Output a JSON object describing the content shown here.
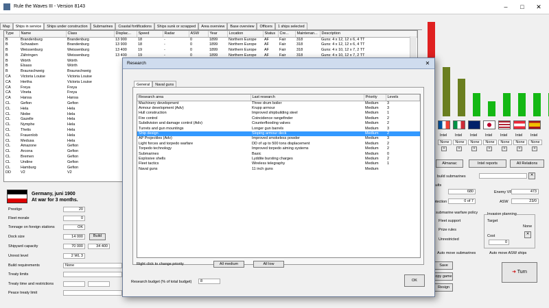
{
  "window": {
    "title": "Rule the Waves III - Version 8143"
  },
  "tabs": [
    "Map",
    "Ships in service",
    "Ships under construction",
    "Submarines",
    "Coastal fortifications",
    "Ships sunk or scrapped",
    "Area overview",
    "Base overview",
    "Officers",
    "1 ships selected"
  ],
  "ship_table": {
    "columns": [
      "Type",
      "Name",
      "Class",
      "Displac...",
      "Speed",
      "Radar",
      "ASW",
      "Year",
      "Location",
      "Status",
      "Cre...",
      "Maintenan...",
      "Description"
    ],
    "rows": [
      [
        "B",
        "Brandenburg",
        "Brandenburg",
        "13 900",
        "18",
        "-",
        "0",
        "1899",
        "Northern Europe",
        "AF",
        "Fair",
        "318",
        "Guns: 4 x 12, 12 x 6, 4 TT"
      ],
      [
        "B",
        "Schwaben",
        "Brandenburg",
        "13 900",
        "18",
        "-",
        "0",
        "1899",
        "Northern Europe",
        "AF",
        "Fair",
        "318",
        "Guns: 4 x 12, 12 x 6, 4 TT"
      ],
      [
        "B",
        "Weissenburg",
        "Weissenburg",
        "13 400",
        "19",
        "-",
        "0",
        "1899",
        "Northern Europe",
        "AF",
        "Fair",
        "318",
        "Guns: 4 x 10, 12 x 7, 2 TT"
      ],
      [
        "B",
        "Zähringen",
        "Weissenburg",
        "13 400",
        "19",
        "-",
        "0",
        "1899",
        "Northern Europe",
        "AF",
        "Fair",
        "318",
        "Guns: 4 x 10, 12 x 7, 2 TT"
      ],
      [
        "B",
        "Wörth",
        "Wörth",
        "",
        "",
        "",
        "",
        "",
        "",
        "",
        "",
        "",
        ""
      ],
      [
        "B",
        "Elsass",
        "Wörth",
        "",
        "",
        "",
        "",
        "",
        "",
        "",
        "",
        "",
        ""
      ],
      [
        "B",
        "Braunschweig",
        "Braunschweig",
        "",
        "",
        "",
        "",
        "",
        "",
        "",
        "",
        "",
        ""
      ],
      [
        "CA",
        "Victoria Louise",
        "Victoria Louise",
        "",
        "",
        "",
        "",
        "",
        "",
        "",
        "",
        "",
        ""
      ],
      [
        "CA",
        "Hertha",
        "Victoria Louise",
        "",
        "",
        "",
        "",
        "",
        "",
        "",
        "",
        "",
        ""
      ],
      [
        "CA",
        "Freya",
        "Freya",
        "",
        "",
        "",
        "",
        "",
        "",
        "",
        "",
        "",
        ""
      ],
      [
        "CA",
        "Vineta",
        "Freya",
        "",
        "",
        "",
        "",
        "",
        "",
        "",
        "",
        "",
        ""
      ],
      [
        "CA",
        "Hansa",
        "Hansa",
        "",
        "",
        "",
        "",
        "",
        "",
        "",
        "",
        "",
        ""
      ],
      [
        "CL",
        "Gefion",
        "Gefion",
        "",
        "",
        "",
        "",
        "",
        "",
        "",
        "",
        "",
        ""
      ],
      [
        "CL",
        "Hela",
        "Hela",
        "",
        "",
        "",
        "",
        "",
        "",
        "",
        "",
        "",
        ""
      ],
      [
        "CL",
        "Niobe",
        "Hela",
        "",
        "",
        "",
        "",
        "",
        "",
        "",
        "",
        "",
        ""
      ],
      [
        "CL",
        "Gazelle",
        "Hela",
        "",
        "",
        "",
        "",
        "",
        "",
        "",
        "",
        "",
        ""
      ],
      [
        "CL",
        "Nymphe",
        "Hela",
        "",
        "",
        "",
        "",
        "",
        "",
        "",
        "",
        "",
        ""
      ],
      [
        "CL",
        "Thetis",
        "Hela",
        "",
        "",
        "",
        "",
        "",
        "",
        "",
        "",
        "",
        ""
      ],
      [
        "CL",
        "Frauenlob",
        "Hela",
        "",
        "",
        "",
        "",
        "",
        "",
        "",
        "",
        "",
        ""
      ],
      [
        "CL",
        "Medusa",
        "Hela",
        "",
        "",
        "",
        "",
        "",
        "",
        "",
        "",
        "",
        ""
      ],
      [
        "CL",
        "Amazone",
        "Gefion",
        "",
        "",
        "",
        "",
        "",
        "",
        "",
        "",
        "",
        ""
      ],
      [
        "CL",
        "Arcona",
        "Gefion",
        "",
        "",
        "",
        "",
        "",
        "",
        "",
        "",
        "",
        ""
      ],
      [
        "CL",
        "Bremen",
        "Gefion",
        "",
        "",
        "",
        "",
        "",
        "",
        "",
        "",
        "",
        ""
      ],
      [
        "CL",
        "Undine",
        "Gefion",
        "",
        "",
        "",
        "",
        "",
        "",
        "",
        "",
        "",
        ""
      ],
      [
        "CL",
        "Hamburg",
        "Gefion",
        "",
        "",
        "",
        "",
        "",
        "",
        "",
        "",
        "",
        ""
      ],
      [
        "DD",
        "V2",
        "V2",
        "",
        "",
        "",
        "",
        "",
        "",
        "",
        "",
        "",
        ""
      ]
    ]
  },
  "status": {
    "country_line1": "Germany, juni 1900",
    "country_line2": "At war for 3 months.",
    "prestige_label": "Prestige",
    "prestige": "20",
    "morale_label": "Fleet morale",
    "morale": "0",
    "tonnage_label": "Tonnage on foreign stations",
    "tonnage": "OK",
    "dock_label": "Dock size",
    "dock": "14 000",
    "build_btn": "Build",
    "shipyard_label": "Shipyard capacity",
    "shipyard1": "70 000",
    "shipyard2": "34 400",
    "unrest_label": "Unrest level",
    "unrest": "2 WL 3",
    "build_req_label": "Build requirements",
    "build_req": "None",
    "treaty_limits": "Treaty limits",
    "treaty_time": "Treaty time and restrictions",
    "peace_treaty": "Peace treaty limit"
  },
  "dialog": {
    "title": "Research",
    "tabs": [
      "General",
      "Naval guns"
    ],
    "columns": [
      "Research area",
      "Last research",
      "Priority",
      "Levels"
    ],
    "rows": [
      [
        "Machinery development",
        "Three drum boiler",
        "Medium",
        "3"
      ],
      [
        "Armour development (Adv)",
        "Krupp armour",
        "Medium",
        "3"
      ],
      [
        "Hull construction",
        "Improved shipbuilding steel",
        "Medium",
        "1"
      ],
      [
        "Fire control",
        "Coincidence rangefinder",
        "Medium",
        "2"
      ],
      [
        "Subdivision and damage control (Adv)",
        "Counterflooding valves",
        "Medium",
        "2"
      ],
      [
        "Turrets and gun mountings",
        "Longer gun barrels",
        "Medium",
        "3"
      ],
      [
        "Ship design",
        "Sloping armour deck",
        "Medium",
        "2"
      ],
      [
        "AP Projectiles (Adv)",
        "Improved smokeless powder",
        "Medium",
        "3"
      ],
      [
        "Light forces and torpedo warfare",
        "DD of up to 500 tons displacement",
        "Medium",
        "2"
      ],
      [
        "Torpedo technology",
        "Improved torpedo aiming systems",
        "Medium",
        "2"
      ],
      [
        "Submarines",
        "Basic",
        "Medium",
        "0"
      ],
      [
        "Explosive shells",
        "Lyddite bursting charges",
        "Medium",
        "2"
      ],
      [
        "Fleet tactics",
        "Wireless telegraphy",
        "Medium",
        "1"
      ],
      [
        "Naval guns",
        "11 inch guns",
        "Medium",
        ""
      ]
    ],
    "selected_row": 6,
    "hint": "Right click to change priority",
    "all_medium": "All medium",
    "all_low": "All low",
    "budget_label": "Research budget (% of total budget)",
    "budget": "8",
    "ok": "OK"
  },
  "right_panel": {
    "bar_values": [
      1.0,
      0.52,
      0.4,
      0.25,
      0.16,
      0.25,
      0.25,
      0.25,
      0.25
    ],
    "bar_colors": [
      "#e02020",
      "#6b7f20",
      "#6b7f20",
      "#14b814",
      "#14b814",
      "#14b814",
      "#14b814",
      "#14b814",
      "#14b814"
    ],
    "intel_labels": [
      "Intel",
      "Intel",
      "Intel",
      "Intel",
      "Intel",
      "Intel",
      "Intel"
    ],
    "none_labels": [
      "None",
      "None",
      "None",
      "None",
      "None",
      "None",
      "None"
    ],
    "almanac_btn": "Almanac",
    "intel_reports_btn": "Intel reports",
    "all_relations_btn": "All Relations",
    "build_subs_label": "build submarines",
    "results_label": "results",
    "results_val": "680",
    "enemy_vp_label": "Enemy VP",
    "enemy_vp": "473",
    "protection_label": "protection",
    "protection_val": "0 of 7",
    "asw_label": "ASW",
    "asw_val": "23/0",
    "warfare_policy_label": "submarine warfare policy",
    "fleet_support": "Fleet support",
    "prize_rules": "Prize rules",
    "unrestricted": "Unrestricted",
    "invasion_label": "Invasion planning",
    "target_label": "Target",
    "target_val": "None",
    "cost_label": "Cost",
    "cost_val": "0",
    "auto_subs": "Auto move submarines",
    "auto_asw": "Auto move ASW ships",
    "save_btn": "Save",
    "copy_game_btn": "opy game",
    "resign_btn": "Resign",
    "turn_btn": "Turn"
  }
}
